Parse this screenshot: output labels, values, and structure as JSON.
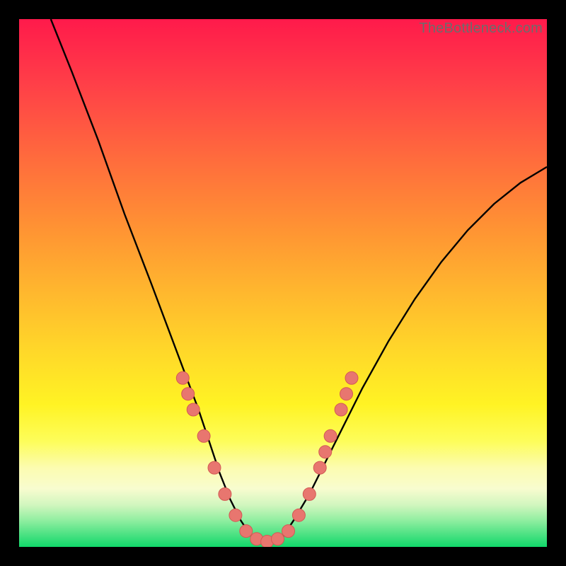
{
  "watermark": "TheBottleneck.com",
  "chart_data": {
    "type": "line",
    "title": "",
    "xlabel": "",
    "ylabel": "",
    "xlim": [
      0,
      100
    ],
    "ylim": [
      0,
      100
    ],
    "series": [
      {
        "name": "bottleneck-curve",
        "x": [
          6,
          10,
          15,
          20,
          25,
          28,
          31,
          34,
          36,
          38,
          40,
          42,
          44,
          46,
          48,
          50,
          52,
          55,
          60,
          65,
          70,
          75,
          80,
          85,
          90,
          95,
          100
        ],
        "y": [
          100,
          90,
          77,
          63,
          50,
          42,
          34,
          26,
          20,
          14,
          9,
          5,
          2,
          1,
          1,
          2,
          5,
          10,
          20,
          30,
          39,
          47,
          54,
          60,
          65,
          69,
          72
        ]
      }
    ],
    "markers": [
      {
        "x": 31,
        "y": 32
      },
      {
        "x": 32,
        "y": 29
      },
      {
        "x": 33,
        "y": 26
      },
      {
        "x": 35,
        "y": 21
      },
      {
        "x": 37,
        "y": 15
      },
      {
        "x": 39,
        "y": 10
      },
      {
        "x": 41,
        "y": 6
      },
      {
        "x": 43,
        "y": 3
      },
      {
        "x": 45,
        "y": 1.5
      },
      {
        "x": 47,
        "y": 1
      },
      {
        "x": 49,
        "y": 1.5
      },
      {
        "x": 51,
        "y": 3
      },
      {
        "x": 53,
        "y": 6
      },
      {
        "x": 55,
        "y": 10
      },
      {
        "x": 57,
        "y": 15
      },
      {
        "x": 58,
        "y": 18
      },
      {
        "x": 59,
        "y": 21
      },
      {
        "x": 61,
        "y": 26
      },
      {
        "x": 62,
        "y": 29
      },
      {
        "x": 63,
        "y": 32
      }
    ],
    "colors": {
      "curve": "#000000",
      "marker_fill": "#e8766f",
      "marker_stroke": "#d25a54"
    }
  }
}
